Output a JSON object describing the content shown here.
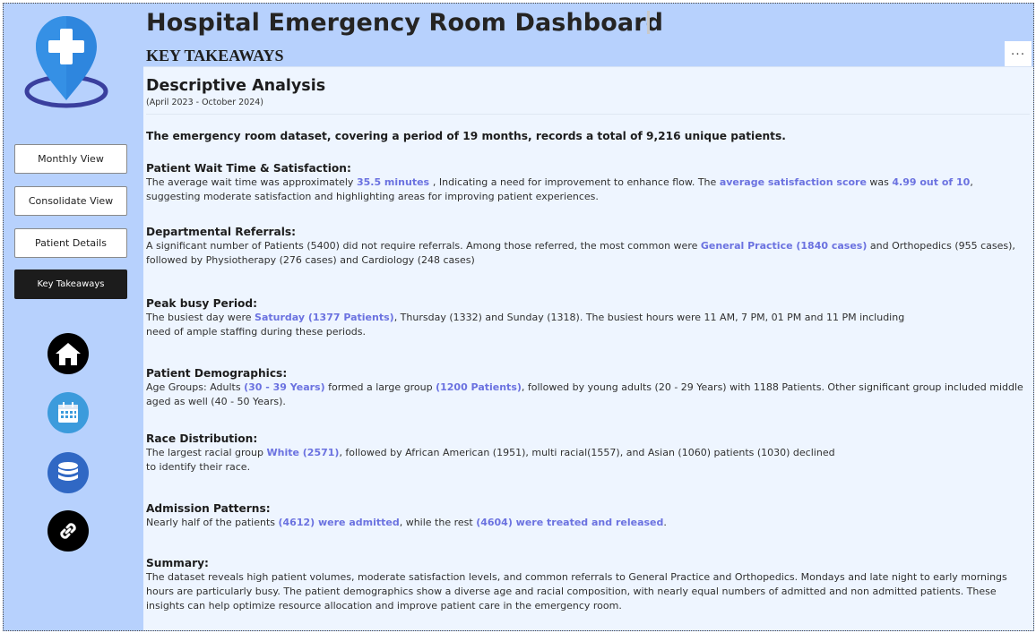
{
  "header": {
    "title": "Hospital Emergency Room Dashboard",
    "subtitle": "KEY TAKEAWAYS",
    "more_label": "···"
  },
  "sidebar": {
    "logo_icon": "map-pin-medical-cross-icon",
    "nav": [
      {
        "label": "Monthly View",
        "active": false
      },
      {
        "label": "Consolidate View",
        "active": false
      },
      {
        "label": "Patient Details",
        "active": false
      },
      {
        "label": "Key Takeaways",
        "active": true
      }
    ],
    "icons": [
      {
        "name": "home-icon",
        "bg": "#000000"
      },
      {
        "name": "calendar-icon",
        "bg": "#3c9bdc"
      },
      {
        "name": "database-icon",
        "bg": "#3068c4"
      },
      {
        "name": "link-icon",
        "bg": "#000000"
      }
    ]
  },
  "panel": {
    "title": "Descriptive Analysis",
    "date_range": "(April 2023 - October 2024)",
    "intro": "The emergency room dataset, covering a period of 19 months, records a total of 9,216 unique patients.",
    "sections": [
      {
        "heading": "Patient Wait Time & Satisfaction:",
        "t1": "The average wait time was approximately ",
        "h1": "35.5 minutes ",
        "t2": ", Indicating a need for improvement to enhance flow. The ",
        "h2": "average satisfaction score",
        "t3": " was ",
        "h3": "4.99 out of 10",
        "t4": ",",
        "line2": "suggesting moderate satisfaction and highlighting areas for improving patient experiences."
      },
      {
        "heading": "Departmental Referrals:",
        "t1": "A significant number of Patients (5400) did not require referrals. Among those referred, the most common were ",
        "h1": "General Practice (1840 cases)",
        "t2": " and Orthopedics (955 cases),",
        "line2": "followed by Physiotherapy (276 cases) and Cardiology (248 cases)"
      },
      {
        "heading": "Peak busy Period:",
        "t1": "The busiest day were ",
        "h1": "Saturday (1377 Patients)",
        "t2": ", Thursday (1332) and Sunday (1318). The busiest hours were 11 AM, 7 PM, 01 PM and 11 PM including",
        "line2": "need of ample staffing during these periods."
      },
      {
        "heading": "Patient Demographics:",
        "t1": "Age Groups: Adults ",
        "h1": "(30 - 39 Years)",
        "t2": " formed a large group ",
        "h2": "(1200 Patients)",
        "t3": ", followed by young adults (20 - 29 Years) with 1188 Patients. Other significant group included middle",
        "line2": "aged as well (40 - 50 Years)."
      },
      {
        "heading": "Race Distribution:",
        "t1": "The largest racial group ",
        "h1": "White (2571)",
        "t2": ", followed by African American (1951), multi racial(1557), and Asian (1060) patients (1030) declined",
        "line2": "to identify their race."
      },
      {
        "heading": "Admission Patterns:",
        "t1": "Nearly half of the patients ",
        "h1": "(4612) were admitted",
        "t2": ", while the rest ",
        "h2": "(4604) were treated and released",
        "t3": "."
      },
      {
        "heading": "Summary:",
        "line1": "The dataset reveals high patient volumes, moderate satisfaction levels, and common referrals to General Practice and Orthopedics. Mondays and late night to early mornings",
        "line2": "hours are particularly busy. The patient demographics show a diverse age and racial composition, with nearly equal numbers of admitted and non admitted patients. These",
        "line3": "insights can help optimize resource allocation and improve patient care in the emergency room."
      }
    ]
  },
  "colors": {
    "background": "#b7d1fd",
    "panel": "#eef5ff",
    "highlight": "#6b72e0",
    "active_nav": "#1c1c1c"
  }
}
